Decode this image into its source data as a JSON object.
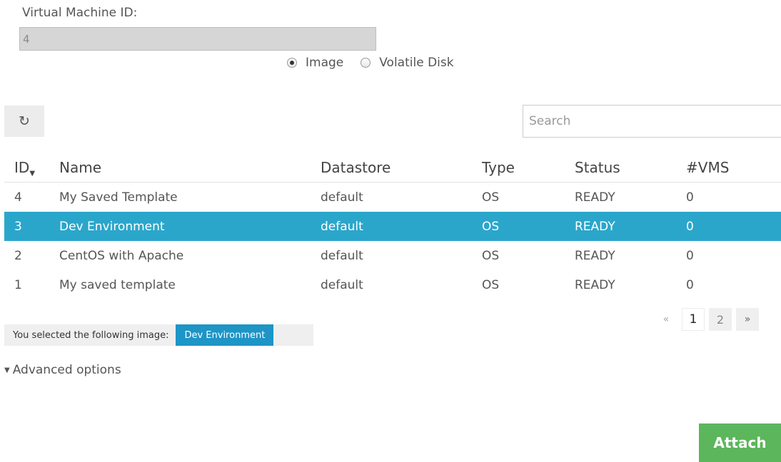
{
  "form": {
    "vm_id_label": "Virtual Machine ID:",
    "vm_id_value": "4",
    "radio_options": [
      {
        "label": "Image",
        "checked": true
      },
      {
        "label": "Volatile Disk",
        "checked": false
      }
    ]
  },
  "toolbar": {
    "refresh_icon": "refresh-icon",
    "refresh_glyph": "↻",
    "search_placeholder": "Search"
  },
  "table": {
    "columns": {
      "id": "ID",
      "name": "Name",
      "datastore": "Datastore",
      "type": "Type",
      "status": "Status",
      "vms": "#VMS"
    },
    "sort_caret": "▼",
    "rows": [
      {
        "id": "4",
        "name": "My Saved Template",
        "datastore": "default",
        "type": "OS",
        "status": "READY",
        "vms": "0",
        "selected": false
      },
      {
        "id": "3",
        "name": "Dev Environment",
        "datastore": "default",
        "type": "OS",
        "status": "READY",
        "vms": "0",
        "selected": true
      },
      {
        "id": "2",
        "name": "CentOS with Apache",
        "datastore": "default",
        "type": "OS",
        "status": "READY",
        "vms": "0",
        "selected": false
      },
      {
        "id": "1",
        "name": "My saved template",
        "datastore": "default",
        "type": "OS",
        "status": "READY",
        "vms": "0",
        "selected": false
      }
    ],
    "selected_color": "#2ba6cb"
  },
  "pagination": {
    "prev": "«",
    "pages": [
      "1",
      "2"
    ],
    "current": "1",
    "next": "»"
  },
  "selection": {
    "label": "You selected the following image:",
    "value": "Dev Environment",
    "badge_color": "#1d95c6"
  },
  "advanced": {
    "caret": "▼",
    "label": "Advanced options"
  },
  "actions": {
    "attach_label": "Attach",
    "attach_color": "#5cb65c"
  }
}
